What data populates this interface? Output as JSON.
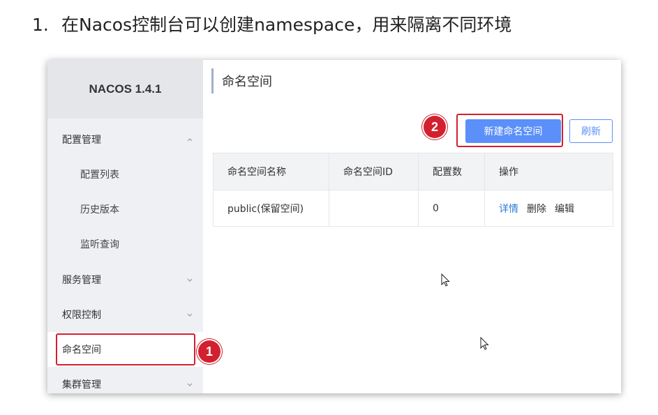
{
  "heading": {
    "number": "1.",
    "text": "在Nacos控制台可以创建namespace，用来隔离不同环境"
  },
  "sidebar": {
    "brand": "NACOS 1.4.1",
    "items": [
      {
        "label": "配置管理",
        "icon": "chevron-up-icon"
      },
      {
        "label": "配置列表"
      },
      {
        "label": "历史版本"
      },
      {
        "label": "监听查询"
      },
      {
        "label": "服务管理",
        "icon": "chevron-down-icon"
      },
      {
        "label": "权限控制",
        "icon": "chevron-down-icon"
      },
      {
        "label": "命名空间",
        "selected": true
      },
      {
        "label": "集群管理",
        "icon": "chevron-down-icon"
      }
    ]
  },
  "annotations": {
    "step1": "1",
    "step2": "2",
    "color": "#d2202f"
  },
  "main": {
    "title": "命名空间",
    "new_button": "新建命名空间",
    "refresh_button": "刷新",
    "table": {
      "columns": [
        "命名空间名称",
        "命名空间ID",
        "配置数",
        "操作"
      ],
      "rows": [
        {
          "name": "public(保留空间)",
          "id": "",
          "count": "0",
          "actions": [
            "详情",
            "删除",
            "编辑"
          ]
        }
      ]
    }
  },
  "colors": {
    "primary": "#5b8ff9",
    "link": "#2d7bd6",
    "sidebar_bg": "#eef0f3"
  }
}
